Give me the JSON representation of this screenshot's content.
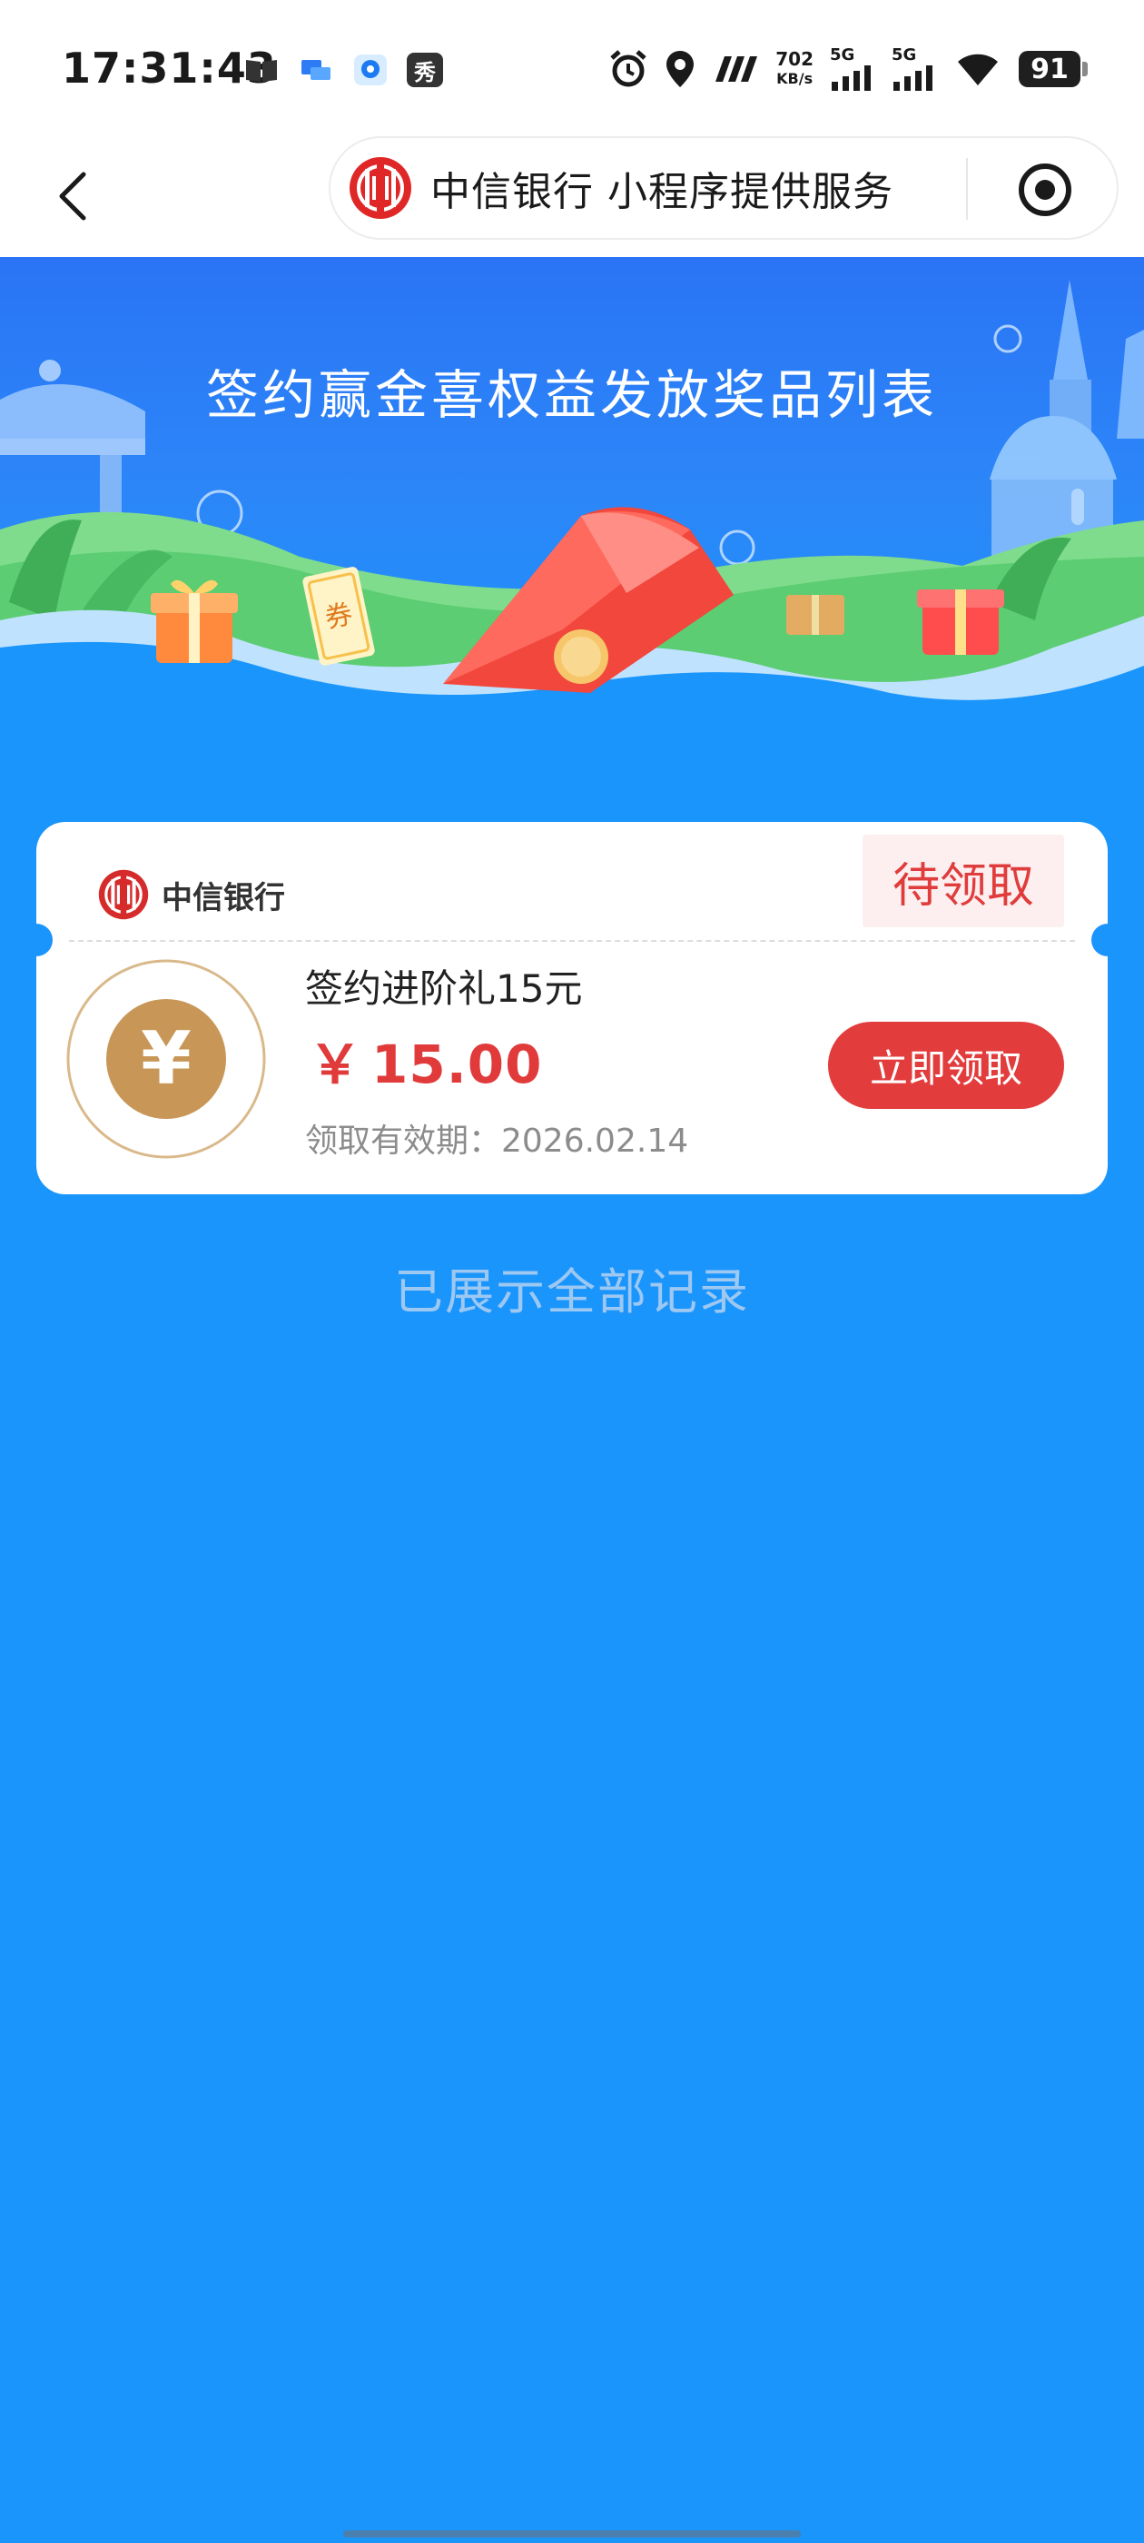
{
  "status_bar": {
    "time": "17:31:43",
    "left_icons": [
      "book-icon",
      "chat-icon",
      "camera-app-icon",
      "xiu-app-icon"
    ],
    "left_icon_text": "秀",
    "net_speed_value": "702",
    "net_speed_unit": "KB/s",
    "signal_1_label": "5G",
    "signal_2_label": "5G",
    "battery": "91"
  },
  "nav": {
    "capsule_title": "中信银行 小程序提供服务"
  },
  "banner": {
    "title": "签约赢金喜权益发放奖品列表",
    "coupon_text": "券"
  },
  "reward": {
    "bank_name": "中信银行",
    "status": "待领取",
    "prize_name": "签约进阶礼15元",
    "currency": "￥",
    "amount": "15.00",
    "expiry": "领取有效期：2026.02.14",
    "claim_label": "立即领取",
    "coin_symbol": "¥"
  },
  "footer": {
    "all_records": "已展示全部记录"
  },
  "colors": {
    "page_bg": "#1a95fc",
    "accent_red": "#e23c3c",
    "badge_bg": "#fdeff0",
    "coin_gold": "#c89758"
  }
}
